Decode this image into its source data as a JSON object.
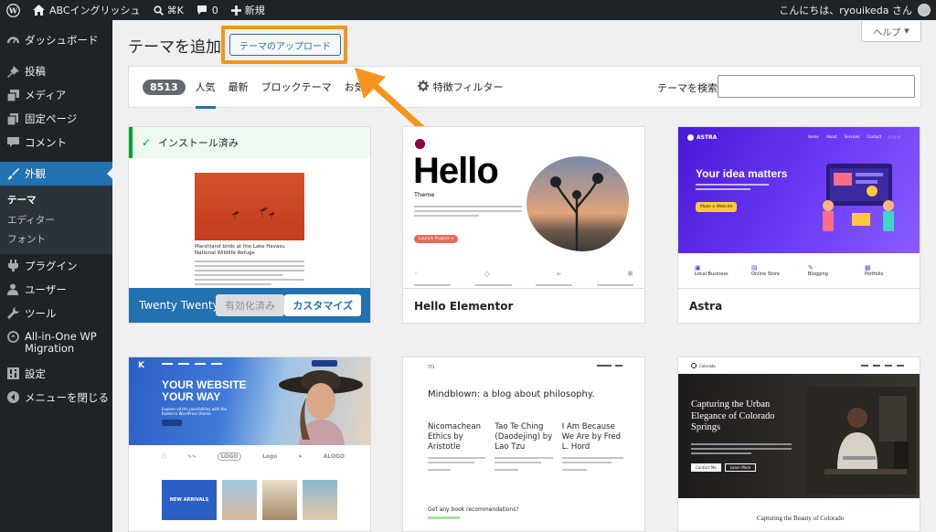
{
  "admin_bar": {
    "site_name": "ABCイングリッシュ",
    "shortcut": "⌘K",
    "comments_count": "0",
    "new_label": "新規",
    "greeting": "こんにちは、ryouikeda さん"
  },
  "sidebar": {
    "items": [
      {
        "label": "ダッシュボード",
        "icon": "dashboard-icon"
      },
      {
        "label": "投稿",
        "icon": "pin-icon"
      },
      {
        "label": "メディア",
        "icon": "media-icon"
      },
      {
        "label": "固定ページ",
        "icon": "page-icon"
      },
      {
        "label": "コメント",
        "icon": "comment-icon"
      },
      {
        "label": "外観",
        "icon": "appearance-icon"
      },
      {
        "label": "プラグイン",
        "icon": "plugin-icon"
      },
      {
        "label": "ユーザー",
        "icon": "user-icon"
      },
      {
        "label": "ツール",
        "icon": "tool-icon"
      },
      {
        "label": "All-in-One WP Migration",
        "icon": "migration-icon"
      },
      {
        "label": "設定",
        "icon": "settings-icon"
      },
      {
        "label": "メニューを閉じる",
        "icon": "collapse-icon"
      }
    ],
    "submenu": [
      "テーマ",
      "エディター",
      "フォント"
    ]
  },
  "header": {
    "title": "テーマを追加",
    "upload_button": "テーマのアップロード",
    "help_button": "ヘルプ"
  },
  "filter_bar": {
    "count": "8513",
    "tabs": [
      "人気",
      "最新",
      "ブロックテーマ",
      "お気"
    ],
    "feature_filter": "特徴フィルター",
    "search_label": "テーマを検索"
  },
  "themes": [
    {
      "name": "Twenty Twenty-F",
      "installed_label": "インストール済み",
      "activated_label": "有効化済み",
      "customize_label": "カスタマイズ",
      "preview_caption": "Marshland birds at the Lake Havasu National Wildlife Refuge"
    },
    {
      "name": "Hello Elementor",
      "preview_heading": "Hello",
      "preview_sub": "Theme",
      "preview_button": "Launch Project →"
    },
    {
      "name": "Astra",
      "preview_logo": "ASTRA",
      "preview_heading": "Your idea matters",
      "preview_button": "Make a Website",
      "preview_nav": [
        "Home",
        "About",
        "Services",
        "Contact"
      ],
      "preview_features": [
        "Local Business",
        "Online Store",
        "Blogging",
        "Portfolio"
      ]
    },
    {
      "name": "",
      "preview_heading": "YOUR WEBSITE YOUR WAY",
      "preview_sub": "Explore all the possibilities with the Kadence WordPress theme.",
      "preview_badge": "NEW ARRIVALS",
      "preview_logos": [
        "LOGO",
        "Logo",
        "ALOGO"
      ]
    },
    {
      "name": "",
      "preview_site": "TT3",
      "preview_heading": "Mindblown: a blog about philosophy.",
      "preview_posts": [
        "Nicomachean Ethics by Aristotle",
        "Tao Te Ching (Daodejing) by Lao Tzu",
        "I Am Because We Are by Fred L. Hord"
      ],
      "preview_footer": "Got any book recommendations?"
    },
    {
      "name": "",
      "preview_site": "Colorado",
      "preview_heading": "Capturing the Urban Elegance of Colorado Springs",
      "preview_footer": "Capturing the Beauty of Colorado",
      "preview_buttons": [
        "Contact Me",
        "Learn More"
      ]
    }
  ],
  "colors": {
    "admin_dark": "#1d2327",
    "accent_blue": "#2271b1",
    "highlight_orange": "#f5941e",
    "installed_green": "#00a32a",
    "astra_purple": "#5b2cf2"
  }
}
